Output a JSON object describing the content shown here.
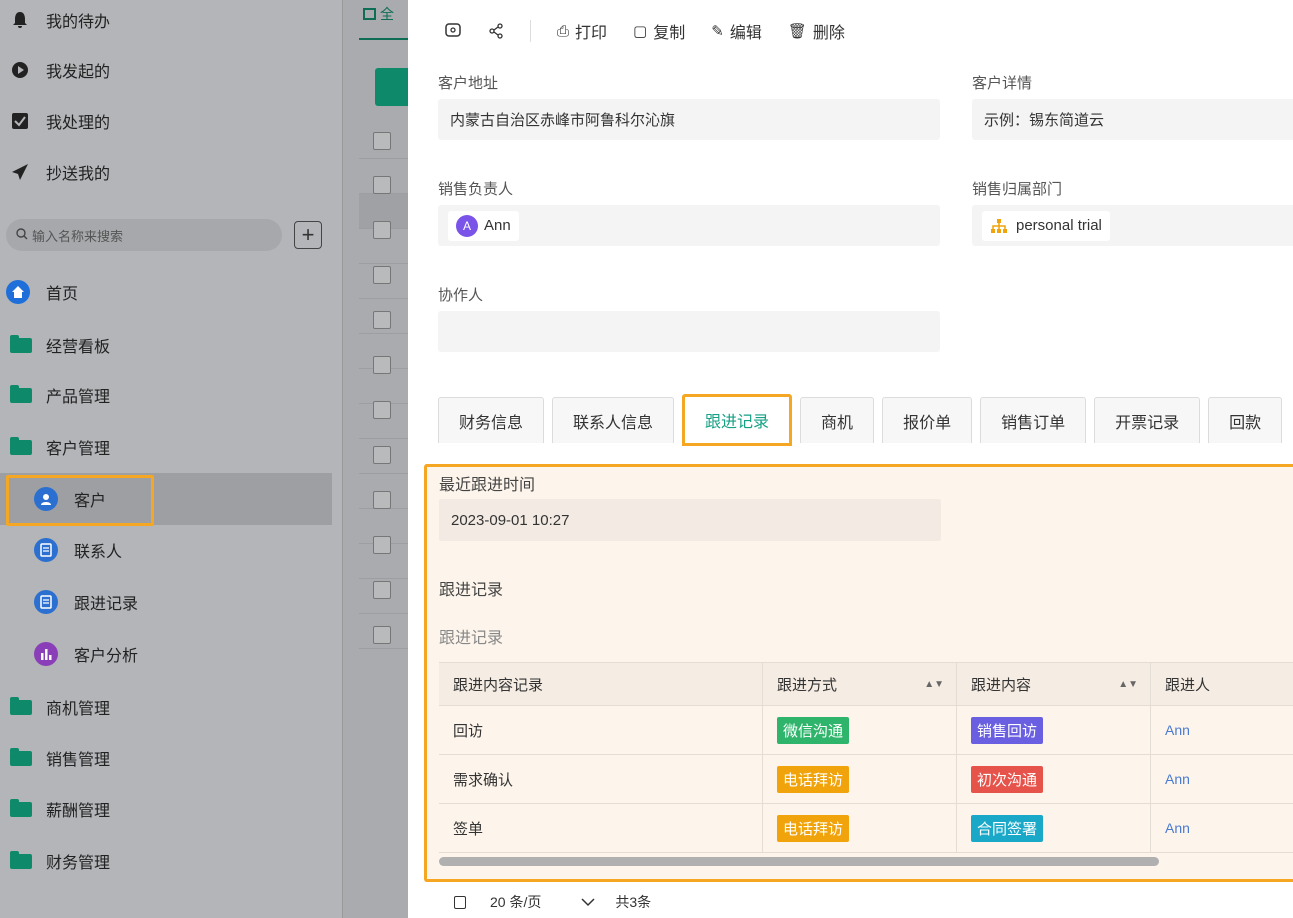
{
  "sidebar": {
    "top_items": [
      {
        "label": "我的待办",
        "icon": "bell-icon"
      },
      {
        "label": "我发起的",
        "icon": "play-circle-icon"
      },
      {
        "label": "我处理的",
        "icon": "check-square-icon"
      },
      {
        "label": "抄送我的",
        "icon": "send-icon"
      }
    ],
    "search_placeholder": "输入名称来搜索",
    "nav": [
      {
        "label": "首页",
        "icon": "home-icon"
      },
      {
        "label": "经营看板",
        "icon": "folder-icon"
      },
      {
        "label": "产品管理",
        "icon": "folder-icon"
      },
      {
        "label": "客户管理",
        "icon": "folder-open-icon"
      },
      {
        "label": "客户",
        "icon": "user-icon"
      },
      {
        "label": "联系人",
        "icon": "document-icon"
      },
      {
        "label": "跟进记录",
        "icon": "document-icon"
      },
      {
        "label": "客户分析",
        "icon": "bar-chart-icon"
      },
      {
        "label": "商机管理",
        "icon": "folder-icon"
      },
      {
        "label": "销售管理",
        "icon": "folder-icon"
      },
      {
        "label": "薪酬管理",
        "icon": "folder-icon"
      },
      {
        "label": "财务管理",
        "icon": "folder-icon"
      }
    ]
  },
  "list_tab_label": "全",
  "toolbar": {
    "print": "打印",
    "copy": "复制",
    "edit": "编辑",
    "delete": "删除"
  },
  "fields": {
    "address_label": "客户地址",
    "address_value": "内蒙古自治区赤峰市阿鲁科尔沁旗",
    "detail_label": "客户详情",
    "detail_value": "示例：锡东简道云",
    "owner_label": "销售负责人",
    "owner_avatar": "A",
    "owner_value": "Ann",
    "dept_label": "销售归属部门",
    "dept_value": "personal trial",
    "collab_label": "协作人"
  },
  "tabs": [
    "财务信息",
    "联系人信息",
    "跟进记录",
    "商机",
    "报价单",
    "销售订单",
    "开票记录",
    "回款"
  ],
  "followup": {
    "last_time_label": "最近跟进时间",
    "last_time_value": "2023-09-01 10:27",
    "record_label": "跟进记录",
    "record_sublabel": "跟进记录",
    "columns": [
      "跟进内容记录",
      "跟进方式",
      "跟进内容",
      "跟进人"
    ],
    "rows": [
      {
        "content": "回访",
        "method": "微信沟通",
        "method_color": "#2fb56b",
        "topic": "销售回访",
        "topic_color": "#6a5fe0",
        "person": "Ann"
      },
      {
        "content": "需求确认",
        "method": "电话拜访",
        "method_color": "#f0a30a",
        "topic": "初次沟通",
        "topic_color": "#e5534b",
        "person": "Ann"
      },
      {
        "content": "签单",
        "method": "电话拜访",
        "method_color": "#f0a30a",
        "topic": "合同签署",
        "topic_color": "#1aa8c9",
        "person": "Ann"
      }
    ]
  },
  "pager": {
    "page_size": "20 条/页",
    "total": "共3条"
  }
}
